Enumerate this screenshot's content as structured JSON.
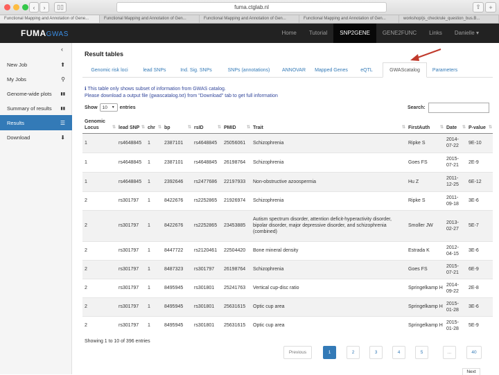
{
  "browser": {
    "url": "fuma.ctglab.nl",
    "tabs": [
      "Functional Mapping and Annotation of Gene...",
      "Functional Mapping and Annotation of Gen...",
      "Functional Mapping and Annotation of Gen...",
      "Functional Mapping and Annotation of Gen...",
      "workshop/js_checkrule_question_bus.B..."
    ]
  },
  "brand": {
    "name": "FUMA",
    "suffix": "GWAS"
  },
  "topnav": {
    "items": [
      "Home",
      "Tutorial",
      "SNP2GENE",
      "GENE2FUNC",
      "Links",
      "Danielle ▾"
    ]
  },
  "sidebar": {
    "collapse": "‹",
    "items": [
      {
        "label": "New Job",
        "icon": "⬆"
      },
      {
        "label": "My Jobs",
        "icon": "⚲"
      },
      {
        "label": "Genome-wide plots",
        "icon": "▮▮"
      },
      {
        "label": "Summary of results",
        "icon": "▮▮"
      },
      {
        "label": "Results",
        "icon": "☰"
      },
      {
        "label": "Download",
        "icon": "⬇"
      }
    ]
  },
  "main": {
    "heading": "Result tables",
    "tabs": [
      "Genomic risk loci",
      "lead SNPs",
      "Ind. Sig. SNPs",
      "SNPs (annotations)",
      "ANNOVAR",
      "Mapped Genes",
      "eQTL",
      "GWAScatalog",
      "Parameters"
    ],
    "info_line1": "This table only shows subset of information from GWAS catalog.",
    "info_line2": "Please download a output file (gwascatalog.txt) from \"Download\" tab to get full information",
    "show_label": "Show",
    "show_value": "10",
    "entries_label": "entries",
    "search_label": "Search:",
    "columns": [
      "Genomic Locus",
      "lead SNP",
      "chr",
      "bp",
      "rsID",
      "PMID",
      "Trait",
      "FirstAuth",
      "Date",
      "P-value"
    ],
    "rows": [
      [
        "1",
        "rs4648845",
        "1",
        "2387101",
        "rs4648845",
        "25056061",
        "Schizophrenia",
        "Ripke S",
        "2014-07-22",
        "9E-10"
      ],
      [
        "1",
        "rs4648845",
        "1",
        "2387101",
        "rs4648845",
        "26198764",
        "Schizophrenia",
        "Goes FS",
        "2015-07-21",
        "2E-9"
      ],
      [
        "1",
        "rs4648845",
        "1",
        "2392646",
        "rs2477686",
        "22197933",
        "Non-obstructive azoospermia",
        "Hu Z",
        "2011-12-25",
        "6E-12"
      ],
      [
        "2",
        "rs301797",
        "1",
        "8422676",
        "rs2252865",
        "21926974",
        "Schizophrenia",
        "Ripke S",
        "2011-09-18",
        "3E-6"
      ],
      [
        "2",
        "rs301797",
        "1",
        "8422676",
        "rs2252865",
        "23453885",
        "Autism spectrum disorder, attention deficit-hyperactivity disorder, bipolar disorder, major depressive disorder, and schizophrenia (combined)",
        "Smoller JW",
        "2013-02-27",
        "5E-7"
      ],
      [
        "2",
        "rs301797",
        "1",
        "8447722",
        "rs2120461",
        "22504420",
        "Bone mineral density",
        "Estrada K",
        "2012-04-15",
        "3E-6"
      ],
      [
        "2",
        "rs301797",
        "1",
        "8487323",
        "rs301797",
        "26198764",
        "Schizophrenia",
        "Goes FS",
        "2015-07-21",
        "6E-9"
      ],
      [
        "2",
        "rs301797",
        "1",
        "8495945",
        "rs301801",
        "25241763",
        "Vertical cup-disc ratio",
        "Springelkamp H",
        "2014-09-22",
        "2E-8"
      ],
      [
        "2",
        "rs301797",
        "1",
        "8495945",
        "rs301801",
        "25631615",
        "Optic cup area",
        "Springelkamp H",
        "2015-01-28",
        "3E-6"
      ],
      [
        "2",
        "rs301797",
        "1",
        "8495945",
        "rs301801",
        "25631615",
        "Optic cup area",
        "Springelkamp H",
        "2015-01-28",
        "5E-9"
      ]
    ],
    "footer": "Showing 1 to 10 of 396 entries",
    "pagination": [
      "Previous",
      "1",
      "2",
      "3",
      "4",
      "5",
      "...",
      "40"
    ],
    "next": "Next"
  },
  "colors": {
    "accent": "#337ab7",
    "navbar": "#222222",
    "annotation_arrow": "#c0392b"
  }
}
